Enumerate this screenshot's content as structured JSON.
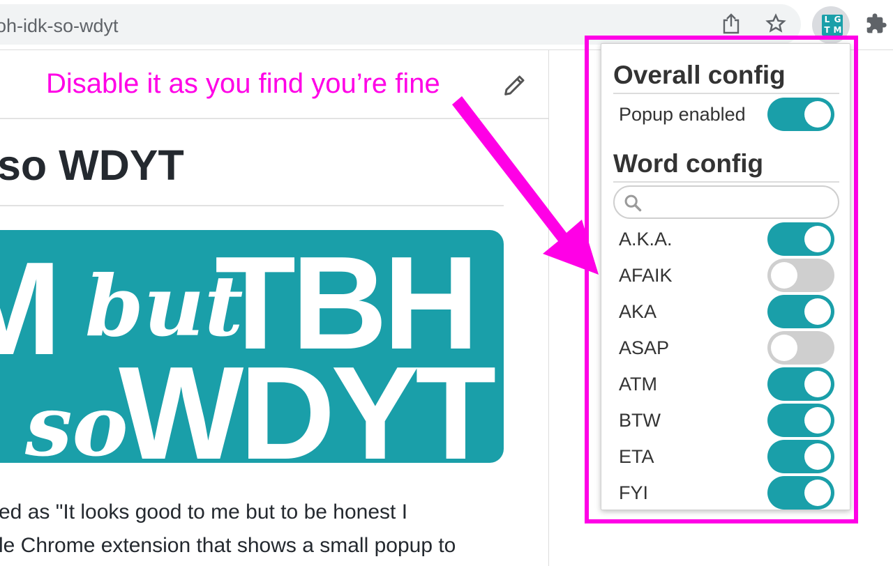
{
  "browser": {
    "url_fragment": "oh-idk-so-wdyt",
    "icons": [
      "share-icon",
      "bookmark-star-icon",
      "lgtm-extension-icon",
      "extensions-puzzle-icon"
    ],
    "extension_logo": [
      "L",
      "G",
      "T",
      "M"
    ]
  },
  "page": {
    "annotation": "Disable it as you find you’re fine",
    "title": "so WDYT",
    "banner": {
      "big_top": "M",
      "script_top": "but",
      "big_top_right": "TBH",
      "script_bottom": "so",
      "big_bottom": "WDYT",
      "color": "#1a9fa9"
    },
    "body_lines": [
      "ed as \"It looks good to me but to be honest I",
      "le Chrome extension that shows a small popup to"
    ]
  },
  "popup": {
    "overall_title": "Overall config",
    "popup_enabled_label": "Popup enabled",
    "popup_enabled": true,
    "word_title": "Word config",
    "search_placeholder": "",
    "words": [
      {
        "label": "A.K.A.",
        "enabled": true
      },
      {
        "label": "AFAIK",
        "enabled": false
      },
      {
        "label": "AKA",
        "enabled": true
      },
      {
        "label": "ASAP",
        "enabled": false
      },
      {
        "label": "ATM",
        "enabled": true
      },
      {
        "label": "BTW",
        "enabled": true
      },
      {
        "label": "ETA",
        "enabled": true
      },
      {
        "label": "FYI",
        "enabled": true
      }
    ]
  },
  "colors": {
    "accent": "#1a9fa9",
    "annotation": "#ff00e6",
    "toggle_off": "#cfcfcf"
  }
}
